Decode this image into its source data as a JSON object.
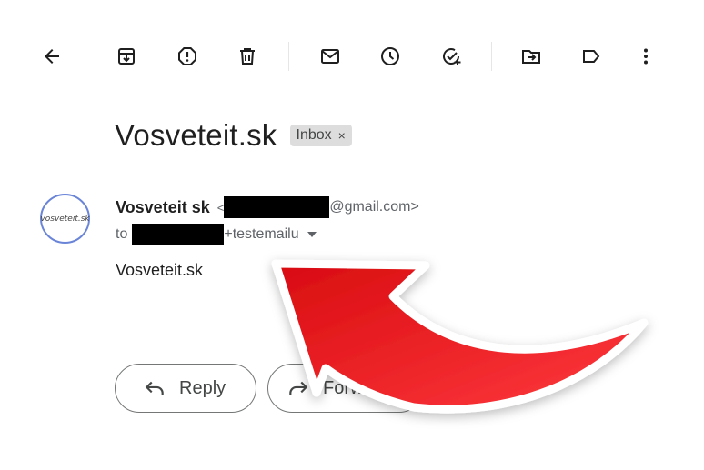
{
  "toolbar": {
    "buttons": [
      {
        "icon": "back-arrow-icon"
      },
      {
        "icon": "archive-icon"
      },
      {
        "icon": "report-spam-icon"
      },
      {
        "icon": "delete-icon"
      },
      {
        "icon": "mark-unread-icon"
      },
      {
        "icon": "snooze-icon"
      },
      {
        "icon": "add-to-tasks-icon"
      },
      {
        "icon": "move-to-icon"
      },
      {
        "icon": "label-icon"
      },
      {
        "icon": "more-options-icon"
      }
    ]
  },
  "message": {
    "subject": "Vosveteit.sk",
    "label": "Inbox",
    "label_remove": "×",
    "avatar_text": "vosveteit.sk",
    "sender_name": "Vosveteit sk",
    "sender_lt": "<",
    "sender_email_domain": "@gmail.com>",
    "to_prefix": "to",
    "to_suffix": "+testemailu",
    "body": "Vosveteit.sk"
  },
  "actions": {
    "reply_label": "Reply",
    "forward_label": "Forward"
  },
  "colors": {
    "avatar_border": "#6a85d8",
    "arrow_red": "#e8242a",
    "chip_bg": "#dddddd"
  }
}
